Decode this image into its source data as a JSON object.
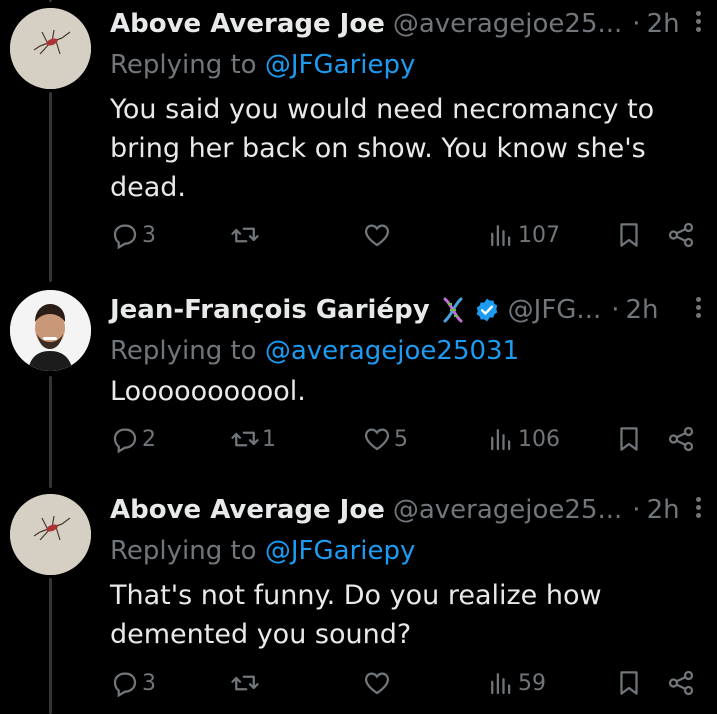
{
  "tweets": [
    {
      "author": "Above Average Joe",
      "handle": "@averagejoe25...",
      "separator": "·",
      "time": "2h",
      "reply_prefix": "Replying to ",
      "reply_to": "@JFGariepy",
      "text": "You said you would need necromancy to bring her back on show. You know she's dead.",
      "replies": "3",
      "retweets": "",
      "likes": "",
      "views": "107"
    },
    {
      "author": "Jean-François Gariépy",
      "handle": "@JFG...",
      "separator": "·",
      "time": "2h",
      "reply_prefix": "Replying to ",
      "reply_to": "@averagejoe25031",
      "text": "Looooooooool.",
      "replies": "2",
      "retweets": "1",
      "likes": "5",
      "views": "106"
    },
    {
      "author": "Above Average Joe",
      "handle": "@averagejoe25...",
      "separator": "·",
      "time": "2h",
      "reply_prefix": "Replying to ",
      "reply_to": "@JFGariepy",
      "text": "That's not funny. Do you realize how demented you sound?",
      "replies": "3",
      "retweets": "",
      "likes": "",
      "views": "59"
    }
  ],
  "icons": {
    "reply": "reply-icon",
    "retweet": "retweet-icon",
    "like": "heart-icon",
    "views": "views-icon",
    "bookmark": "bookmark-icon",
    "share": "share-icon",
    "more": "more-icon",
    "dna": "dna-emoji-icon",
    "verified": "verified-badge-icon"
  },
  "colors": {
    "background": "#000000",
    "text": "#e7e9ea",
    "muted": "#71767b",
    "link": "#1d9bf0"
  }
}
